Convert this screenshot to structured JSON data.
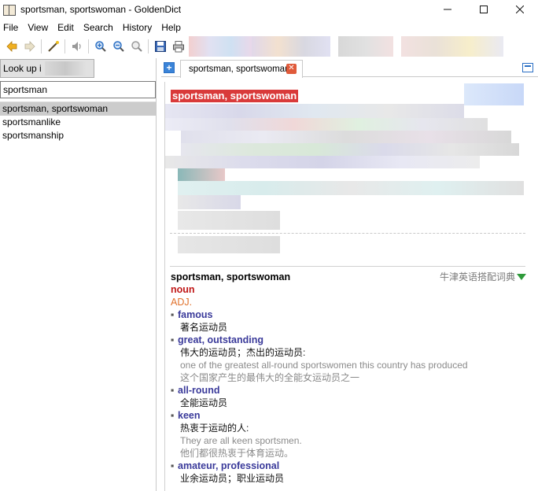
{
  "window": {
    "title": "sportsman, sportswoman - GoldenDict"
  },
  "menu": [
    "File",
    "View",
    "Edit",
    "Search",
    "History",
    "Help"
  ],
  "left": {
    "lookup_label": "Look up i",
    "search_value": "sportsman",
    "words": [
      "sportsman, sportswoman",
      "sportsmanlike",
      "sportsmanship"
    ]
  },
  "tab": {
    "label": "sportsman, sportswoman"
  },
  "article": {
    "first_headword": "sportsman, sportswoman",
    "entry": {
      "headword": "sportsman, sportswoman",
      "dictionary": "牛津英语搭配词典",
      "pos": "noun",
      "section": "ADJ.",
      "collocations": [
        {
          "word": "famous",
          "lines": [
            {
              "text": "著名运动员",
              "style": "zh"
            }
          ]
        },
        {
          "word": "great, outstanding",
          "lines": [
            {
              "text": "伟大的运动员；杰出的运动员:",
              "style": "zh"
            },
            {
              "text": "one of the greatest all-round sportswomen this country has produced",
              "style": "ex"
            },
            {
              "text": "这个国家产生的最伟大的全能女运动员之一",
              "style": "ex"
            }
          ]
        },
        {
          "word": "all-round",
          "lines": [
            {
              "text": "全能运动员",
              "style": "zh"
            }
          ]
        },
        {
          "word": "keen",
          "lines": [
            {
              "text": "热衷于运动的人:",
              "style": "zh"
            },
            {
              "text": "They are all keen sportsmen.",
              "style": "ex"
            },
            {
              "text": "他们都很热衷于体育运动。",
              "style": "ex"
            }
          ]
        },
        {
          "word": "amateur, professional",
          "lines": [
            {
              "text": "业余运动员；职业运动员",
              "style": "zh"
            }
          ]
        }
      ]
    }
  },
  "colors": {
    "highlight": "#d93a3a",
    "pos": "#c01818",
    "section": "#e0702a",
    "keyword": "#3a3a9a",
    "example": "#8a8a8a"
  }
}
